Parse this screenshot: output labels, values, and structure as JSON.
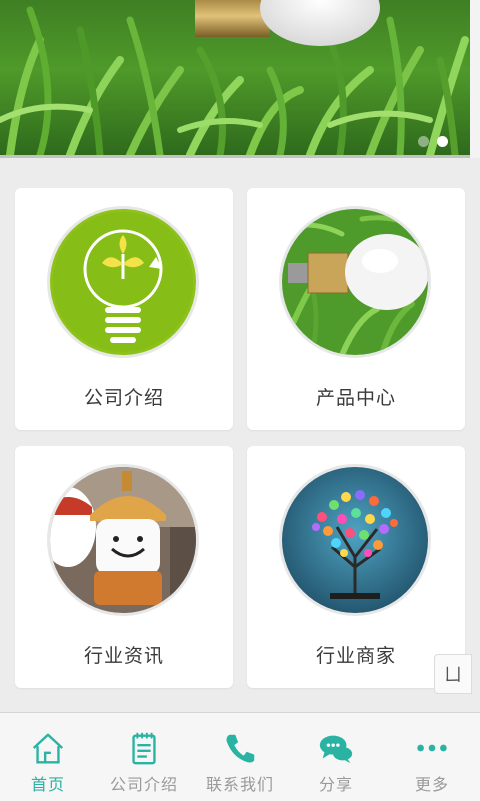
{
  "banner": {
    "slide_count": 2,
    "active_slide": 2
  },
  "cards": [
    {
      "label": "公司介绍",
      "icon": "bulb-leaf-icon"
    },
    {
      "label": "产品中心",
      "icon": "led-bulb-icon"
    },
    {
      "label": "行业资讯",
      "icon": "lantern-icon"
    },
    {
      "label": "行业商家",
      "icon": "light-tree-icon"
    }
  ],
  "float_button": {
    "label": "ㄩ"
  },
  "tabbar": {
    "items": [
      {
        "label": "首页",
        "icon": "home-icon",
        "active": true
      },
      {
        "label": "公司介绍",
        "icon": "notepad-icon",
        "active": false
      },
      {
        "label": "联系我们",
        "icon": "phone-icon",
        "active": false
      },
      {
        "label": "分享",
        "icon": "chat-bubbles-icon",
        "active": false
      },
      {
        "label": "更多",
        "icon": "more-dots-icon",
        "active": false
      }
    ]
  },
  "colors": {
    "accent": "#2ab3a3",
    "card_bg": "#ffffff",
    "page_bg": "#ececec"
  }
}
